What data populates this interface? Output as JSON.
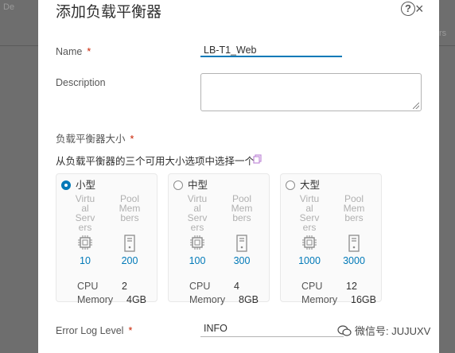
{
  "background": {
    "left_tab": "De",
    "right_text": "rs"
  },
  "dialog": {
    "title": "添加负载平衡器",
    "help_glyph": "?",
    "close_glyph": "×"
  },
  "form": {
    "name_label": "Name",
    "name_value": "LB-T1_Web",
    "description_label": "Description",
    "description_value": "",
    "required_mark": "*",
    "size_label": "负载平衡器大小",
    "size_helper": "从负载平衡器的三个可用大小选项中选择一个",
    "error_log_label": "Error Log Level",
    "error_log_value": "INFO"
  },
  "sizes": [
    {
      "name": "小型",
      "selected": true,
      "col1_lines": [
        "Virtu",
        "al",
        "Serv",
        "ers"
      ],
      "col2_lines": [
        "Pool",
        "Mem",
        "bers"
      ],
      "virtual_servers": "10",
      "pool_members": "200",
      "cpu_label": "CPU",
      "cpu": "2",
      "memory_label": "Memory",
      "memory": "4GB"
    },
    {
      "name": "中型",
      "selected": false,
      "col1_lines": [
        "Virtu",
        "al",
        "Serv",
        "ers"
      ],
      "col2_lines": [
        "Pool",
        "Mem",
        "bers"
      ],
      "virtual_servers": "100",
      "pool_members": "300",
      "cpu_label": "CPU",
      "cpu": "4",
      "memory_label": "Memory",
      "memory": "8GB"
    },
    {
      "name": "大型",
      "selected": false,
      "col1_lines": [
        "Virtu",
        "al",
        "Serv",
        "ers"
      ],
      "col2_lines": [
        "Pool",
        "Mem",
        "bers"
      ],
      "virtual_servers": "1000",
      "pool_members": "3000",
      "cpu_label": "CPU",
      "cpu": "12",
      "memory_label": "Memory",
      "memory": "16GB"
    }
  ],
  "watermark": {
    "text": "微信号: JUJUXV"
  },
  "colors": {
    "accent": "#0079b8",
    "required": "#c92100",
    "muted_text": "#b0b0b0"
  }
}
